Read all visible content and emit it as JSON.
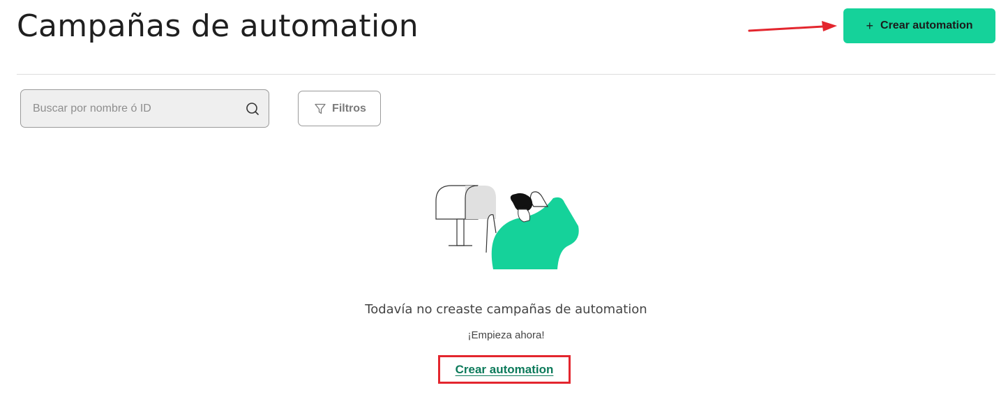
{
  "page": {
    "title": "Campañas de automation"
  },
  "header": {
    "create_button_icon": "plus-icon",
    "create_button_label": "Crear automation",
    "accent_color": "#15d29a"
  },
  "toolbar": {
    "search_placeholder": "Buscar por nombre ó ID",
    "search_value": "",
    "search_icon": "search-icon",
    "filter_icon": "filter-icon",
    "filter_label": "Filtros"
  },
  "empty_state": {
    "illustration": "person-mailbox-illustration",
    "title": "Todavía no creaste campañas de automation",
    "subtitle": "¡Empieza ahora!",
    "link_label": "Crear automation",
    "link_color": "#0c7a5a"
  },
  "annotations": {
    "arrow_color": "#e3262e",
    "highlight_box_color": "#e3262e"
  }
}
